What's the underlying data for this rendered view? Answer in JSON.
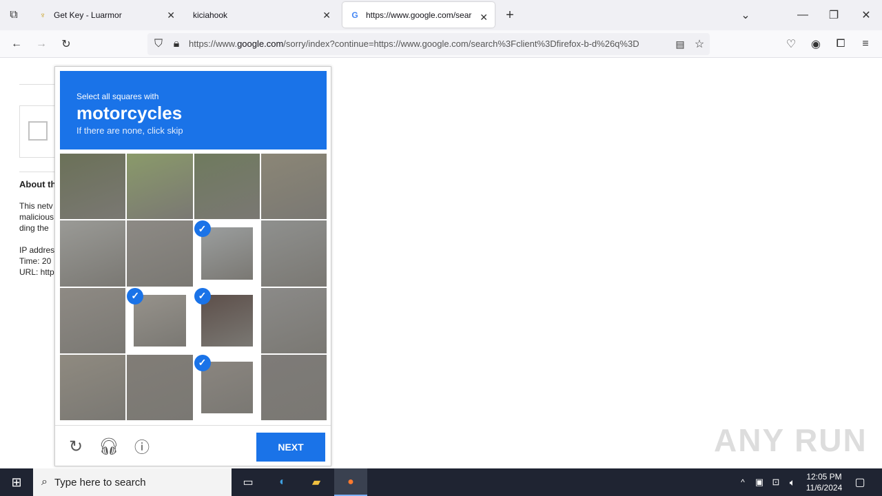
{
  "browser": {
    "tabs": [
      {
        "title": "Get Key - Luarmor",
        "icon": "luarmor-icon"
      },
      {
        "title": "kiciahook",
        "icon": ""
      },
      {
        "title": "https://www.google.com/sear",
        "icon": "google-icon"
      }
    ],
    "url_prefix": "https://www.",
    "url_domain": "google.com",
    "url_rest": "/sorry/index?continue=https://www.google.com/search%3Fclient%3Dfirefox-b-d%26q%3D"
  },
  "page": {
    "about_heading": "About th",
    "lines": [
      "This netv",
      "malicious",
      "ding the",
      "IP addres",
      "Time: 20",
      "URL: http"
    ]
  },
  "captcha": {
    "instruction": "Select all squares with",
    "target": "motorcycles",
    "hint": "If there are none, click skip",
    "next_label": "NEXT",
    "selected_cells": [
      6,
      9,
      10,
      14
    ],
    "cell_colors": [
      "#6b7158",
      "#8a9a6a",
      "#6f7a5e",
      "#8b8676",
      "#9a9a96",
      "#8d8a85",
      "#9b9e9e",
      "#8f908e",
      "#8e8a84",
      "#96928b",
      "#5d4f4a",
      "#8b8a88",
      "#8f8a80",
      "#817d77",
      "#8a857f",
      "#7e7b78"
    ]
  },
  "taskbar": {
    "search_placeholder": "Type here to search",
    "time": "12:05 PM",
    "date": "11/6/2024"
  },
  "watermark": "ANY RUN"
}
